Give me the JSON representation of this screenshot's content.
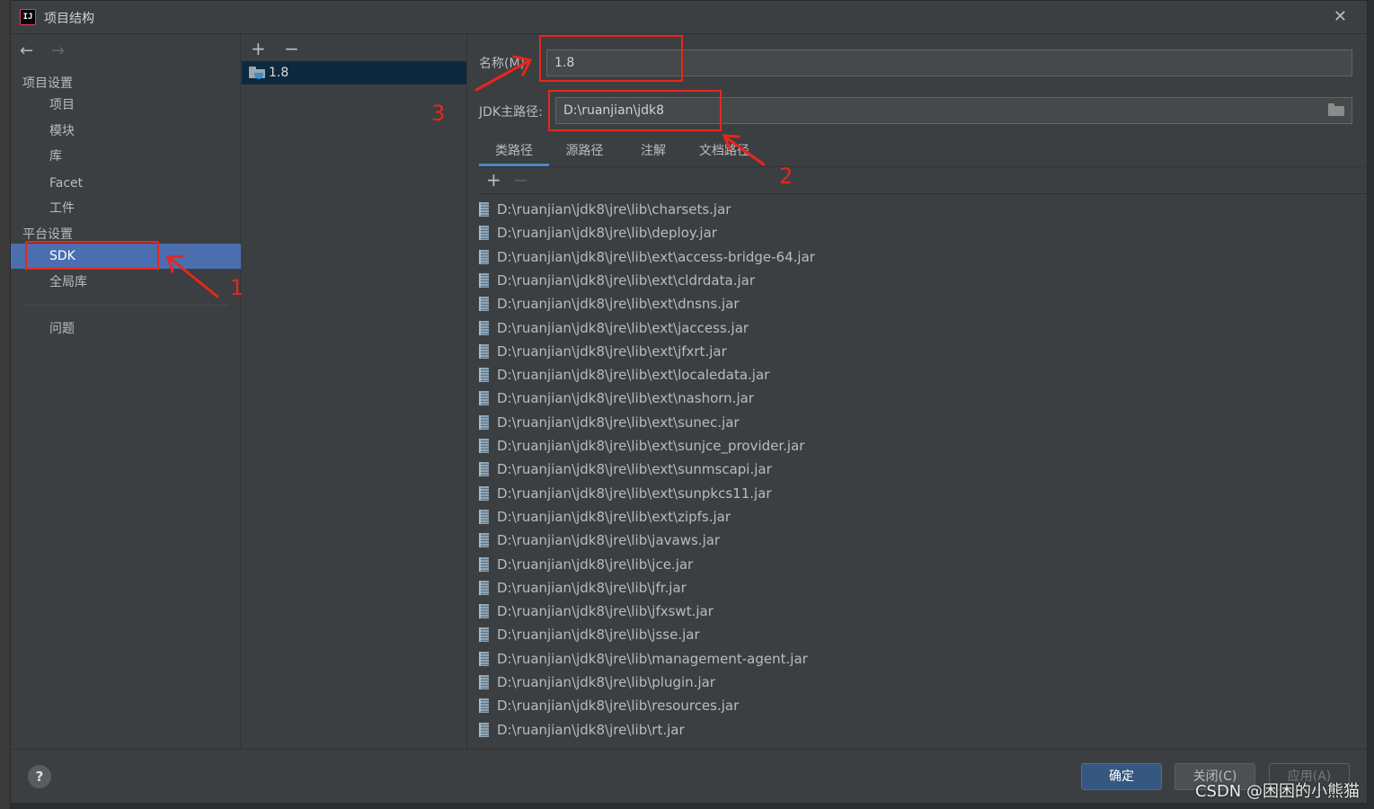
{
  "window": {
    "title": "项目结构"
  },
  "nav": {
    "back_icon": "←",
    "forward_icon": "→",
    "section_project": "项目设置",
    "items_project": [
      "项目",
      "模块",
      "库",
      "Facet",
      "工件"
    ],
    "section_platform": "平台设置",
    "items_platform": [
      "SDK",
      "全局库"
    ],
    "problems": "问题"
  },
  "sdk_list": {
    "add_icon": "+",
    "remove_icon": "−",
    "items": [
      "1.8"
    ]
  },
  "form": {
    "name_label": "名称(M):",
    "name_value": "1.8",
    "jdk_label": "JDK主路径:",
    "jdk_value": "D:\\ruanjian\\jdk8"
  },
  "tabs": [
    "类路径",
    "源路径",
    "注解",
    "文档路径"
  ],
  "classpath": [
    "D:\\ruanjian\\jdk8\\jre\\lib\\charsets.jar",
    "D:\\ruanjian\\jdk8\\jre\\lib\\deploy.jar",
    "D:\\ruanjian\\jdk8\\jre\\lib\\ext\\access-bridge-64.jar",
    "D:\\ruanjian\\jdk8\\jre\\lib\\ext\\cldrdata.jar",
    "D:\\ruanjian\\jdk8\\jre\\lib\\ext\\dnsns.jar",
    "D:\\ruanjian\\jdk8\\jre\\lib\\ext\\jaccess.jar",
    "D:\\ruanjian\\jdk8\\jre\\lib\\ext\\jfxrt.jar",
    "D:\\ruanjian\\jdk8\\jre\\lib\\ext\\localedata.jar",
    "D:\\ruanjian\\jdk8\\jre\\lib\\ext\\nashorn.jar",
    "D:\\ruanjian\\jdk8\\jre\\lib\\ext\\sunec.jar",
    "D:\\ruanjian\\jdk8\\jre\\lib\\ext\\sunjce_provider.jar",
    "D:\\ruanjian\\jdk8\\jre\\lib\\ext\\sunmscapi.jar",
    "D:\\ruanjian\\jdk8\\jre\\lib\\ext\\sunpkcs11.jar",
    "D:\\ruanjian\\jdk8\\jre\\lib\\ext\\zipfs.jar",
    "D:\\ruanjian\\jdk8\\jre\\lib\\javaws.jar",
    "D:\\ruanjian\\jdk8\\jre\\lib\\jce.jar",
    "D:\\ruanjian\\jdk8\\jre\\lib\\jfr.jar",
    "D:\\ruanjian\\jdk8\\jre\\lib\\jfxswt.jar",
    "D:\\ruanjian\\jdk8\\jre\\lib\\jsse.jar",
    "D:\\ruanjian\\jdk8\\jre\\lib\\management-agent.jar",
    "D:\\ruanjian\\jdk8\\jre\\lib\\plugin.jar",
    "D:\\ruanjian\\jdk8\\jre\\lib\\resources.jar",
    "D:\\ruanjian\\jdk8\\jre\\lib\\rt.jar"
  ],
  "footer": {
    "help": "?",
    "ok": "确定",
    "close": "关闭(C)",
    "apply": "应用(A)"
  },
  "annotations": [
    "1",
    "2",
    "3"
  ],
  "watermark": "CSDN @困困的小熊猫",
  "colors": {
    "selection": "#4b6eaf",
    "annotation": "#e8261c",
    "primary_button": "#365880"
  }
}
